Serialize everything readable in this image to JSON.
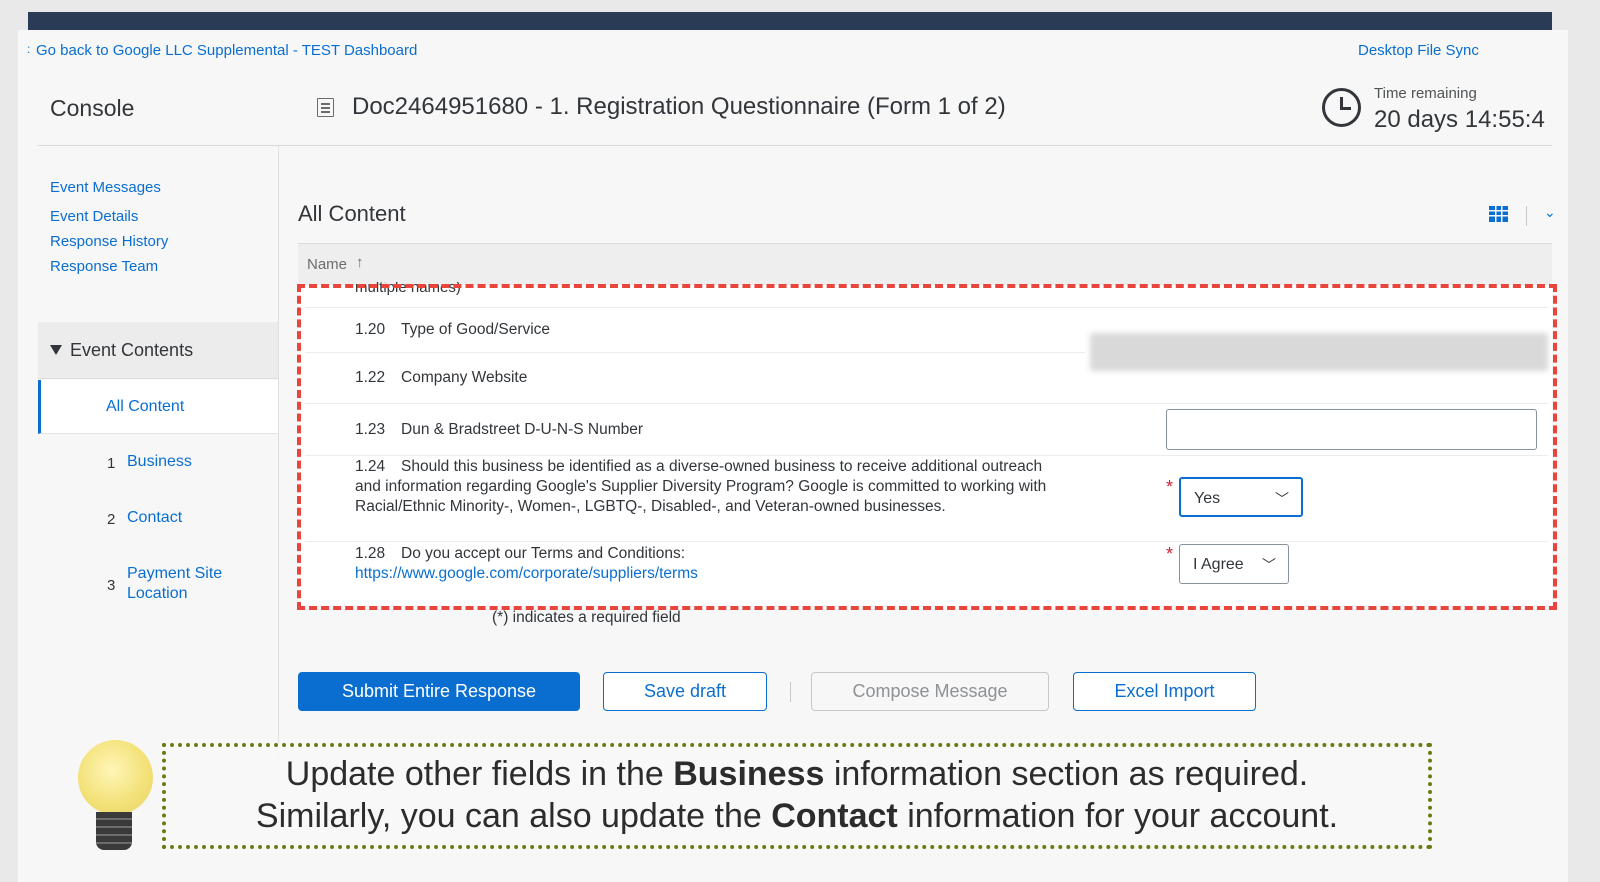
{
  "header": {
    "back_link": "Go back to Google LLC Supplemental - TEST Dashboard",
    "sync_link": "Desktop File Sync",
    "console": "Console",
    "doc_title": "Doc2464951680 - 1. Registration Questionnaire (Form 1 of 2)",
    "time_label": "Time remaining",
    "time_value": "20 days 14:55:4"
  },
  "sidebar": {
    "links": [
      "Event Messages",
      "Event Details",
      "Response History",
      "Response Team"
    ],
    "event_contents": "Event Contents",
    "all_content": "All Content",
    "sections": [
      {
        "num": "1",
        "label": "Business"
      },
      {
        "num": "2",
        "label": "Contact"
      },
      {
        "num": "3",
        "label": "Payment Site Location"
      }
    ]
  },
  "main": {
    "title": "All Content",
    "column_name": "Name",
    "cut_text": "multiple names)",
    "questions": [
      {
        "num": "1.20",
        "text": "Type of Good/Service"
      },
      {
        "num": "1.22",
        "text": "Company Website"
      },
      {
        "num": "1.23",
        "text": "Dun & Bradstreet D-U-N-S Number"
      },
      {
        "num": "1.24",
        "text": "Should this business be identified as a diverse-owned business to receive additional outreach and information regarding Google's Supplier Diversity Program? Google is committed to working with Racial/Ethnic Minority-, Women-, LGBTQ-, Disabled-, and Veteran-owned businesses."
      },
      {
        "num": "1.28",
        "text": "Do you accept our Terms and Conditions:"
      }
    ],
    "terms_link": "https://www.google.com/corporate/suppliers/terms",
    "diverse_value": "Yes",
    "terms_value": "I Agree",
    "required_star": "*",
    "required_note": "(*) indicates a required field"
  },
  "buttons": {
    "submit": "Submit Entire Response",
    "save_draft": "Save draft",
    "compose": "Compose Message",
    "excel": "Excel Import"
  },
  "tip": {
    "line1_pre": "Update other fields in the ",
    "line1_bold": "Business",
    "line1_post": " information section as required.",
    "line2_pre": "Similarly, you can also update the ",
    "line2_bold": "Contact",
    "line2_post": " information for your account."
  },
  "colors": {
    "accent": "#0a6ed1",
    "highlight_frame": "#e8453c",
    "tip_border": "#6b7a12",
    "topbar": "#2a3b55"
  }
}
